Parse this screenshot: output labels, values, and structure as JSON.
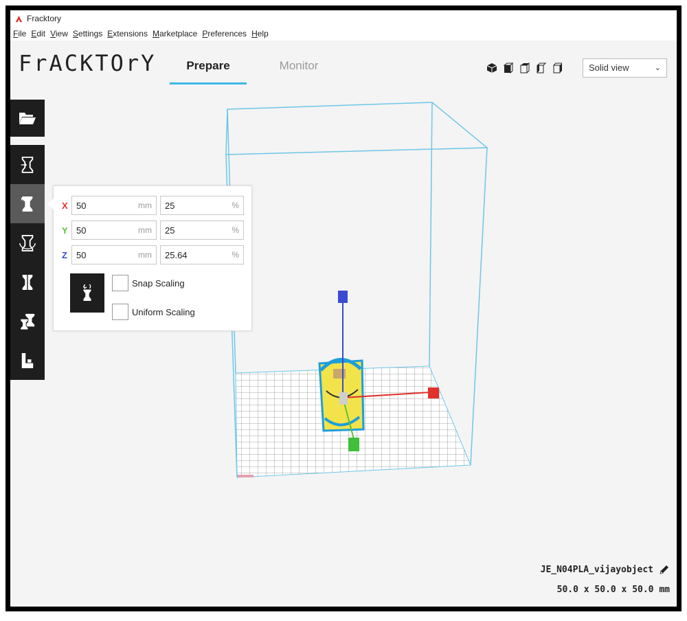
{
  "window": {
    "title": "Fracktory"
  },
  "menu": [
    "File",
    "Edit",
    "View",
    "Settings",
    "Extensions",
    "Marketplace",
    "Preferences",
    "Help"
  ],
  "header": {
    "brand": "FrACKTOrY",
    "tabs": [
      {
        "label": "Prepare",
        "active": true
      },
      {
        "label": "Monitor",
        "active": false
      }
    ],
    "view_select": {
      "value": "Solid view"
    },
    "view_icons": [
      "view-3d-icon",
      "view-front-icon",
      "view-top-icon",
      "view-left-icon",
      "view-right-icon"
    ]
  },
  "toolbar": {
    "open_icon": "folder-open-icon",
    "tools": [
      "move-icon",
      "scale-icon",
      "rotate-icon",
      "mirror-icon",
      "per-model-settings-icon",
      "support-blocker-icon"
    ],
    "active_tool": "scale-icon"
  },
  "scale_panel": {
    "rows": [
      {
        "axis": "X",
        "color": "#e0312c",
        "mm": "50",
        "mm_unit": "mm",
        "pct": "25",
        "pct_unit": "%"
      },
      {
        "axis": "Y",
        "color": "#5bc236",
        "mm": "50",
        "mm_unit": "mm",
        "pct": "25",
        "pct_unit": "%"
      },
      {
        "axis": "Z",
        "color": "#3a4bd1",
        "mm": "50",
        "mm_unit": "mm",
        "pct": "25.64",
        "pct_unit": "%"
      }
    ],
    "snap_scaling": "Snap Scaling",
    "uniform_scaling": "Uniform Scaling"
  },
  "object": {
    "name": "JE_N04PLA_vijayobject",
    "dimensions": "50.0 x 50.0 x 50.0 mm"
  },
  "colors": {
    "accent": "#3db8e6",
    "toolbar": "#1e1e1e",
    "volume_outline": "#6ec6e8",
    "model": "#f2e34a"
  }
}
